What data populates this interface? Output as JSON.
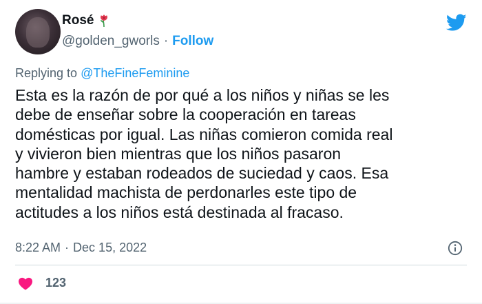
{
  "author": {
    "display_name": "Rosé",
    "handle": "@golden_gworls",
    "follow_label": "Follow",
    "badge_icon": "rose-icon"
  },
  "reply": {
    "prefix": "Replying to ",
    "mention": "@TheFineFeminine"
  },
  "tweet": {
    "lines": [
      "Esta es la razón de por qué a los niños y niñas se les",
      "debe de enseñar sobre la cooperación en tareas",
      "domésticas por igual. Las niñas comieron comida real",
      "y vivieron bien mientras que los niños pasaron",
      "hambre y estaban rodeados de suciedad y caos. Esa",
      "mentalidad machista de perdonarles este tipo de",
      "actitudes a los niños está destinada al fracaso."
    ],
    "time": "8:22 AM",
    "date": "Dec 15, 2022",
    "separator": "·",
    "likes": "123"
  },
  "colors": {
    "accent": "#1d9bf0",
    "secondary_text": "#536471",
    "heart": "#f91880"
  }
}
